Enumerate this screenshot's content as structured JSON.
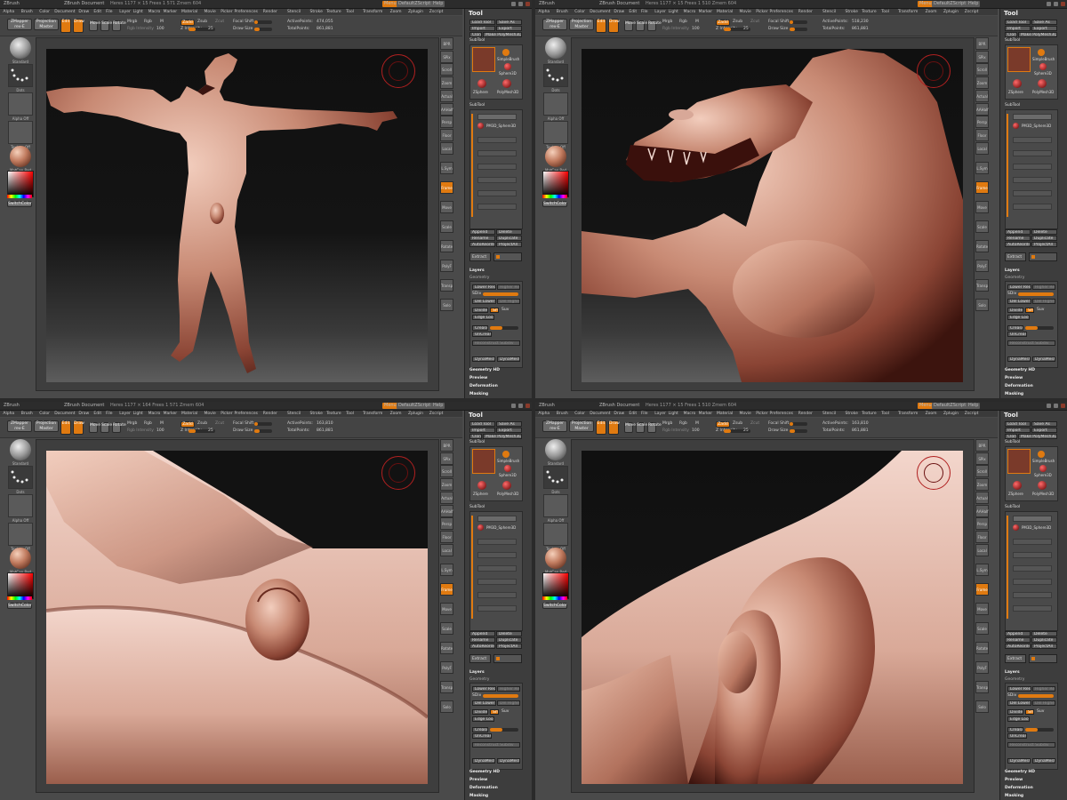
{
  "app": {
    "name": "ZBrush",
    "document_label": "ZBrush Document",
    "menu_button": "Menus",
    "script_button": "DefaultZScript",
    "help_button": "Help"
  },
  "menus": [
    "Alpha",
    "Brush",
    "Color",
    "Document",
    "Draw",
    "Edit",
    "File",
    "Layer",
    "Light",
    "Macro",
    "Marker",
    "Material",
    "Movie",
    "Picker",
    "Preferences",
    "Render",
    "Stencil",
    "Stroke",
    "Texture",
    "Tool",
    "Transform",
    "Zoom",
    "Zplugin",
    "Zscript"
  ],
  "toolbar": {
    "button_1": "ZMapper rev-E",
    "button_2": "Projection Master",
    "edit_label": "Edit",
    "draw_label": "Draw",
    "move_label": "Move",
    "scale_label": "Scale",
    "rotate_label": "Rotate",
    "mrgb_label": "Mrgb",
    "rgb_label": "Rgb",
    "m_label": "M",
    "rgb_intensity_label": "Rgb Intensity",
    "rgb_intensity_value": "100",
    "zadd_label": "Zadd",
    "zsub_label": "Zsub",
    "zcut_label": "Zcut",
    "z_intensity_label": "Z Intensity",
    "z_intensity_value": "25",
    "focal_shift_label": "Focal Shift",
    "focal_shift_value": "0",
    "draw_size_label": "Draw Size",
    "draw_size_value": "64",
    "active_points_label": "ActivePoints:",
    "total_points_label": "TotalPoints:"
  },
  "left_tray": {
    "brush_label": "Standard",
    "stroke_label": "Dots",
    "alpha_label": "Alpha Off",
    "texture_label": "Texture Off",
    "material_label": "MatCap Red",
    "color_label": "SwitchColor"
  },
  "right_shelf": [
    "BPR",
    "SPix",
    "Scroll",
    "Zoom",
    "Actual",
    "AAHalf",
    "Persp",
    "Floor",
    "Local",
    "L.Sym",
    "Frame",
    "Move",
    "Scale",
    "Rotate",
    "PolyF",
    "Transp",
    "Solo"
  ],
  "tool_panel": {
    "title": "Tool",
    "load_tool": "Load Tool",
    "save_as": "Save As",
    "import": "Import",
    "export": "Export",
    "clone": "Clone",
    "make_polymesh": "Make PolyMesh3D",
    "tool_name": "SubTool",
    "thumb_1": "SimpleBrush",
    "thumb_2": "Sphere3D",
    "thumb_3": "ZSphere",
    "thumb_4": "PolyMesh3D",
    "subtool_label": "SubTool",
    "subtool_item": "PM3D_Sphere3D",
    "append": "Append",
    "delete": "Delete",
    "rename": "Rename",
    "dup": "Duplicate",
    "autoreorder": "AutoReorder",
    "project_all": "ProjectAll",
    "extract": "Extract",
    "layers": "Layers",
    "geometry_title": "Geometry",
    "lower_res": "Lower Res",
    "higher_res": "Higher Res",
    "sdiv": "SDiv",
    "del_lower": "Del Lower",
    "del_higher": "Del Higher",
    "divide": "Divide",
    "smt": "Smt",
    "suv": "Suv",
    "edge_loop": "Edge Loop",
    "crease": "Crease",
    "uncrease": "UnCrease",
    "reconstruct": "Reconstruct Subdiv",
    "dynamesh": "DynaMesh",
    "geometry_hd": "Geometry HD",
    "preview": "Preview",
    "deformation": "Deformation",
    "masking": "Masking"
  },
  "panes": [
    {
      "stats": "Heres 1177 × 15 Frees 1 571 Zmem 604",
      "active_points": "474,055",
      "total_points": "861,881",
      "view": "full-body"
    },
    {
      "stats": "Heres 1177 × 15 Frees 1 510 Zmem 604",
      "active_points": "518,230",
      "total_points": "861,881",
      "view": "head-closeup"
    },
    {
      "stats": "Heres 1177 × 164 Frees 1 571 Zmem 604",
      "active_points": "163,810",
      "total_points": "861,881",
      "view": "groin-closeup"
    },
    {
      "stats": "Heres 1177 × 15 Frees 1 510 Zmem 604",
      "active_points": "163,810",
      "total_points": "861,881",
      "view": "rear-closeup"
    }
  ],
  "colors": {
    "accent": "#e07a10",
    "skin_light": "#e8b8a6",
    "skin_dark": "#5a2018",
    "ui_bg": "#4a4a4a",
    "gizmo": "#b02020"
  }
}
